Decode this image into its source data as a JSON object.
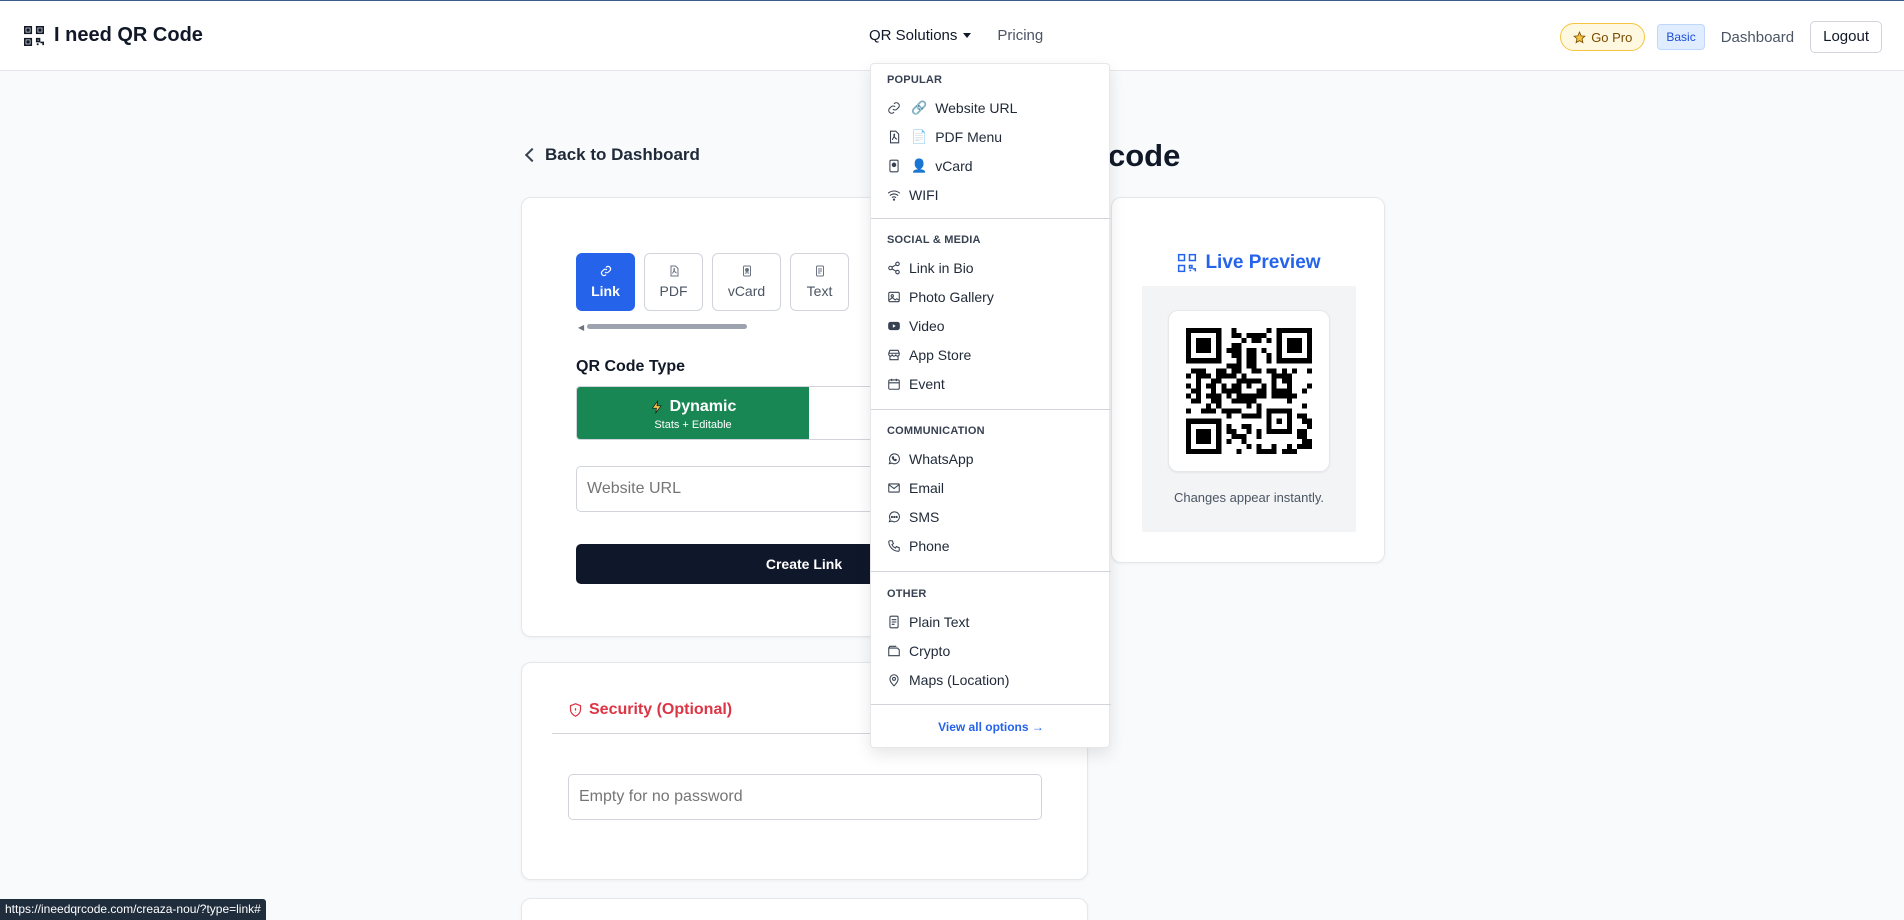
{
  "navbar": {
    "brand": "I need QR Code",
    "links": {
      "qr_solutions": "QR Solutions",
      "pricing": "Pricing"
    },
    "go_pro": "Go Pro",
    "plan_badge": "Basic",
    "dashboard": "Dashboard",
    "logout": "Logout"
  },
  "page": {
    "back": "Back to Dashboard",
    "title_visible": "code"
  },
  "tabs": [
    {
      "label": "Link",
      "icon": "link-icon",
      "active": true
    },
    {
      "label": "PDF",
      "icon": "pdf-icon",
      "active": false
    },
    {
      "label": "vCard",
      "icon": "vcard-icon",
      "active": false
    },
    {
      "label": "Text",
      "icon": "text-icon",
      "active": false
    }
  ],
  "qr_type": {
    "label": "QR Code Type",
    "dynamic_title": "Dynamic",
    "dynamic_sub": "Stats + Editable"
  },
  "form": {
    "url_placeholder": "Website URL",
    "create_button": "Create Link"
  },
  "security": {
    "title": "Security (Optional)",
    "password_placeholder": "Empty for no password"
  },
  "preview": {
    "title": "Live Preview",
    "note": "Changes appear instantly."
  },
  "dropdown": {
    "sections": [
      {
        "header": "POPULAR",
        "items": [
          {
            "label": "Website URL",
            "emoji": "🔗",
            "icon": "link-icon"
          },
          {
            "label": "PDF Menu",
            "emoji": "📄",
            "icon": "pdf-icon"
          },
          {
            "label": "vCard",
            "emoji": "👤",
            "icon": "vcard-icon"
          },
          {
            "label": "WIFI",
            "emoji": "",
            "icon": "wifi-icon"
          }
        ]
      },
      {
        "header": "SOCIAL & MEDIA",
        "items": [
          {
            "label": "Link in Bio",
            "icon": "share-icon"
          },
          {
            "label": "Photo Gallery",
            "icon": "image-icon"
          },
          {
            "label": "Video",
            "icon": "video-icon"
          },
          {
            "label": "App Store",
            "icon": "store-icon"
          },
          {
            "label": "Event",
            "icon": "calendar-icon"
          }
        ]
      },
      {
        "header": "COMMUNICATION",
        "items": [
          {
            "label": "WhatsApp",
            "icon": "whatsapp-icon"
          },
          {
            "label": "Email",
            "icon": "email-icon"
          },
          {
            "label": "SMS",
            "icon": "chat-icon"
          },
          {
            "label": "Phone",
            "icon": "phone-icon"
          }
        ]
      },
      {
        "header": "OTHER",
        "items": [
          {
            "label": "Plain Text",
            "icon": "text-icon"
          },
          {
            "label": "Crypto",
            "icon": "wallet-icon"
          },
          {
            "label": "Maps (Location)",
            "icon": "pin-icon"
          }
        ]
      }
    ],
    "footer": "View all options →"
  },
  "status_url": "https://ineedqrcode.com/creaza-nou/?type=link#",
  "colors": {
    "primary": "#2563eb",
    "dynamic_green": "#198754",
    "danger": "#dc3545",
    "dark_button": "#0f172a"
  }
}
